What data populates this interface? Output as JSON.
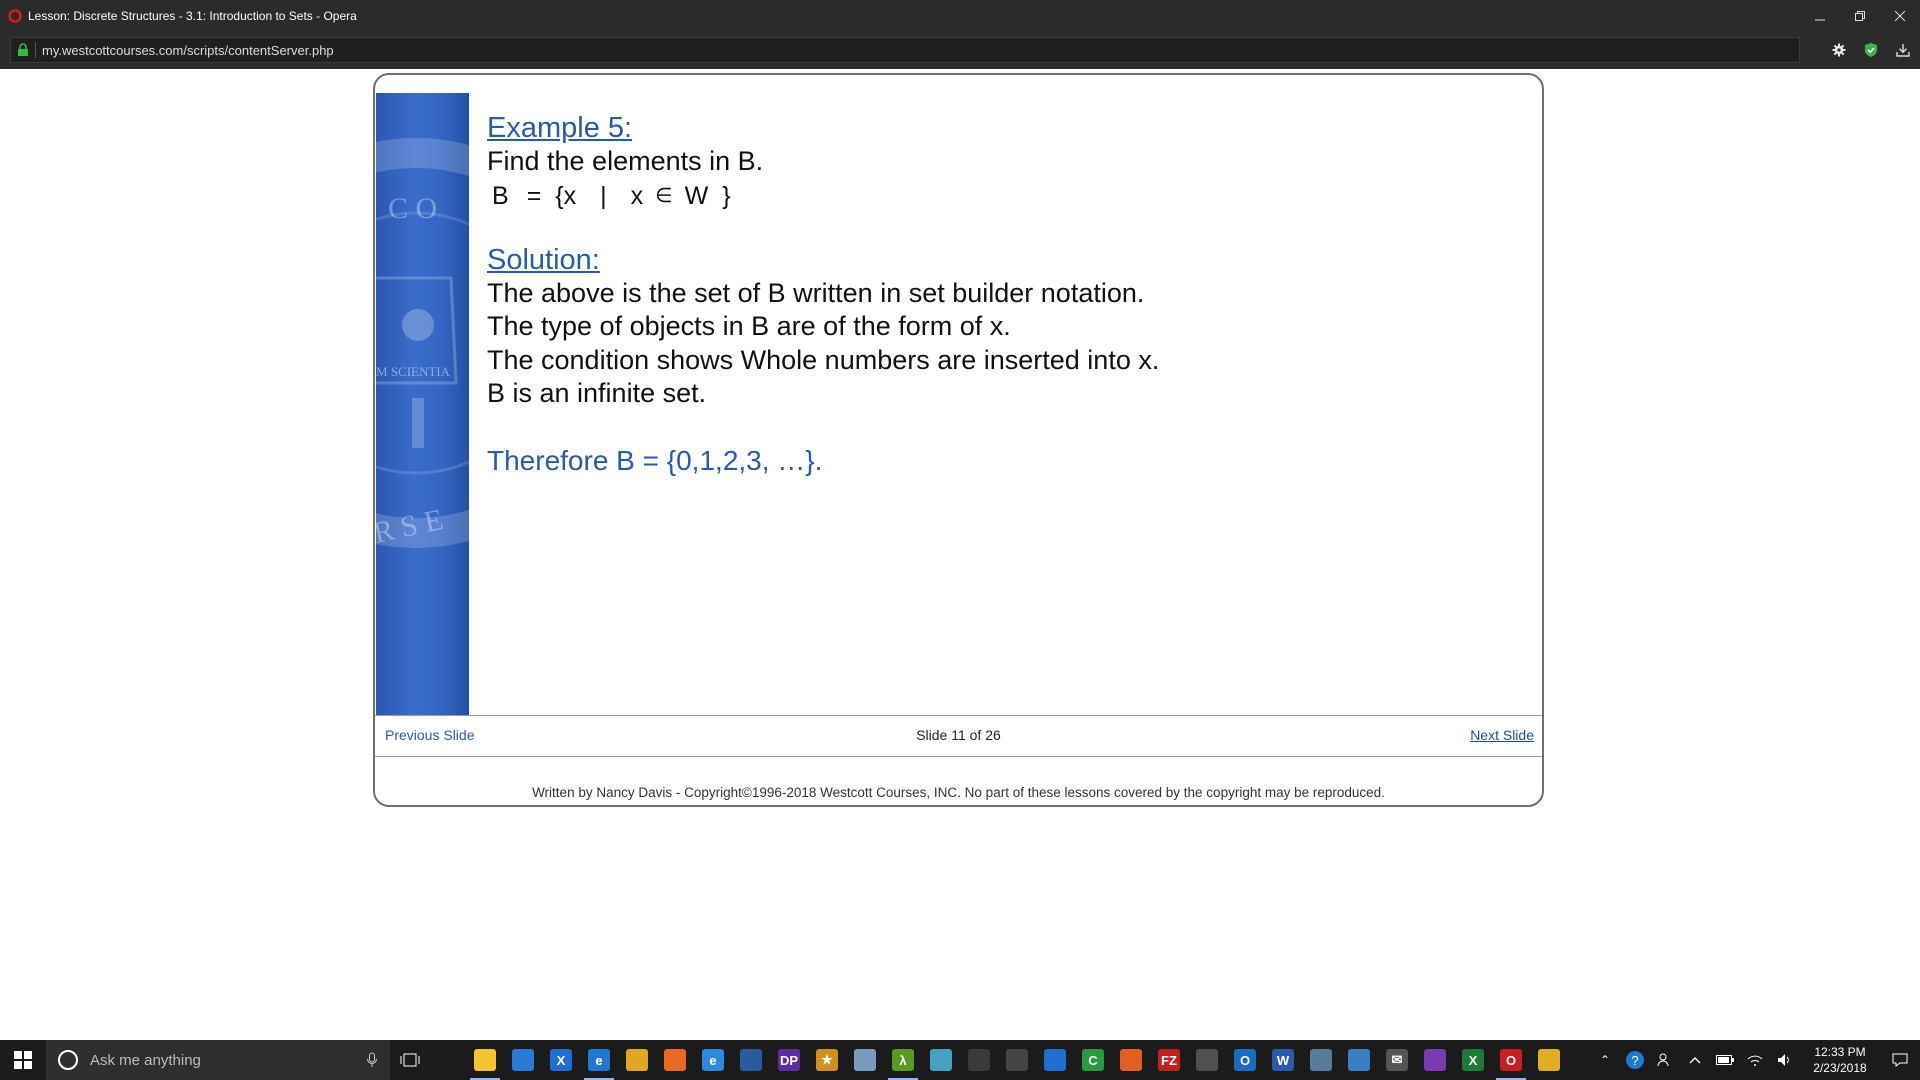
{
  "window": {
    "title": "Lesson: Discrete Structures - 3.1: Introduction to Sets - Opera"
  },
  "addressbar": {
    "url": "my.westcottcourses.com/scripts/contentServer.php"
  },
  "slide": {
    "example_heading": "Example 5:",
    "prompt": "Find the elements in B.",
    "formula": {
      "set": "B",
      "equals": "=",
      "lbrace": "{",
      "var": "x",
      "bar": "|",
      "var2": "x",
      "in": "∈",
      "universe": "W",
      "rbrace": "}"
    },
    "solution_heading": "Solution:",
    "solution_lines": [
      "The above is the set of B written in set builder notation.",
      "The type of objects in B are of the form of x.",
      "The condition shows Whole numbers are inserted into x.",
      "B is an infinite set."
    ],
    "conclusion": "Therefore B = {0,1,2,3, …}."
  },
  "navigation": {
    "previous": "Previous Slide",
    "counter": "Slide 11 of 26",
    "next": "Next Slide"
  },
  "footer": {
    "copyright": "Written by Nancy Davis - Copyright©1996-2018 Westcott Courses, INC. No part of these lessons covered by the copyright may be reproduced."
  },
  "taskbar": {
    "search_placeholder": "Ask me anything",
    "apps": [
      {
        "name": "file-explorer-icon",
        "color": "#f4c430",
        "label": ""
      },
      {
        "name": "store-icon",
        "color": "#2b7bd4",
        "label": ""
      },
      {
        "name": "visual-studio-x-icon",
        "color": "#1e6fd0",
        "label": "X"
      },
      {
        "name": "edge-icon",
        "color": "#1e78d4",
        "label": "e"
      },
      {
        "name": "chrome-icon",
        "color": "#e0a820",
        "label": ""
      },
      {
        "name": "firefox-icon",
        "color": "#e86a20",
        "label": ""
      },
      {
        "name": "internet-explorer-icon",
        "color": "#2a8ae0",
        "label": "e"
      },
      {
        "name": "powershell-icon",
        "color": "#2a5aa0",
        "label": ""
      },
      {
        "name": "dp-icon",
        "color": "#5a2ea0",
        "label": "DP"
      },
      {
        "name": "star-app-icon",
        "color": "#d09020",
        "label": "★"
      },
      {
        "name": "paint-icon",
        "color": "#7a9ac0",
        "label": ""
      },
      {
        "name": "lambda-icon",
        "color": "#5a9a20",
        "label": "λ"
      },
      {
        "name": "notes-icon",
        "color": "#4aa0c0",
        "label": ""
      },
      {
        "name": "game-icon",
        "color": "#3a3a3a",
        "label": ""
      },
      {
        "name": "calculator-icon",
        "color": "#444444",
        "label": ""
      },
      {
        "name": "teamviewer-icon",
        "color": "#1e6fd0",
        "label": ""
      },
      {
        "name": "camtasia-icon",
        "color": "#2a9a40",
        "label": "C"
      },
      {
        "name": "xampp-icon",
        "color": "#e06020",
        "label": ""
      },
      {
        "name": "filezilla-icon",
        "color": "#c02020",
        "label": "FZ"
      },
      {
        "name": "terminal-icon",
        "color": "#505050",
        "label": ""
      },
      {
        "name": "outlook-icon",
        "color": "#1e6ac0",
        "label": "O"
      },
      {
        "name": "word-icon",
        "color": "#2a5aa8",
        "label": "W"
      },
      {
        "name": "network-icon",
        "color": "#5a7a9a",
        "label": ""
      },
      {
        "name": "outlook2-icon",
        "color": "#3a80c0",
        "label": ""
      },
      {
        "name": "mail-icon",
        "color": "#555555",
        "label": "✉"
      },
      {
        "name": "visual-studio-icon",
        "color": "#7a3ab0",
        "label": ""
      },
      {
        "name": "excel-icon",
        "color": "#1f7a3a",
        "label": "X"
      },
      {
        "name": "opera-icon",
        "color": "#c81f26",
        "label": "O"
      },
      {
        "name": "media-icon",
        "color": "#e0b020",
        "label": ""
      }
    ],
    "clock_time": "12:33 PM",
    "clock_date": "2/23/2018"
  }
}
